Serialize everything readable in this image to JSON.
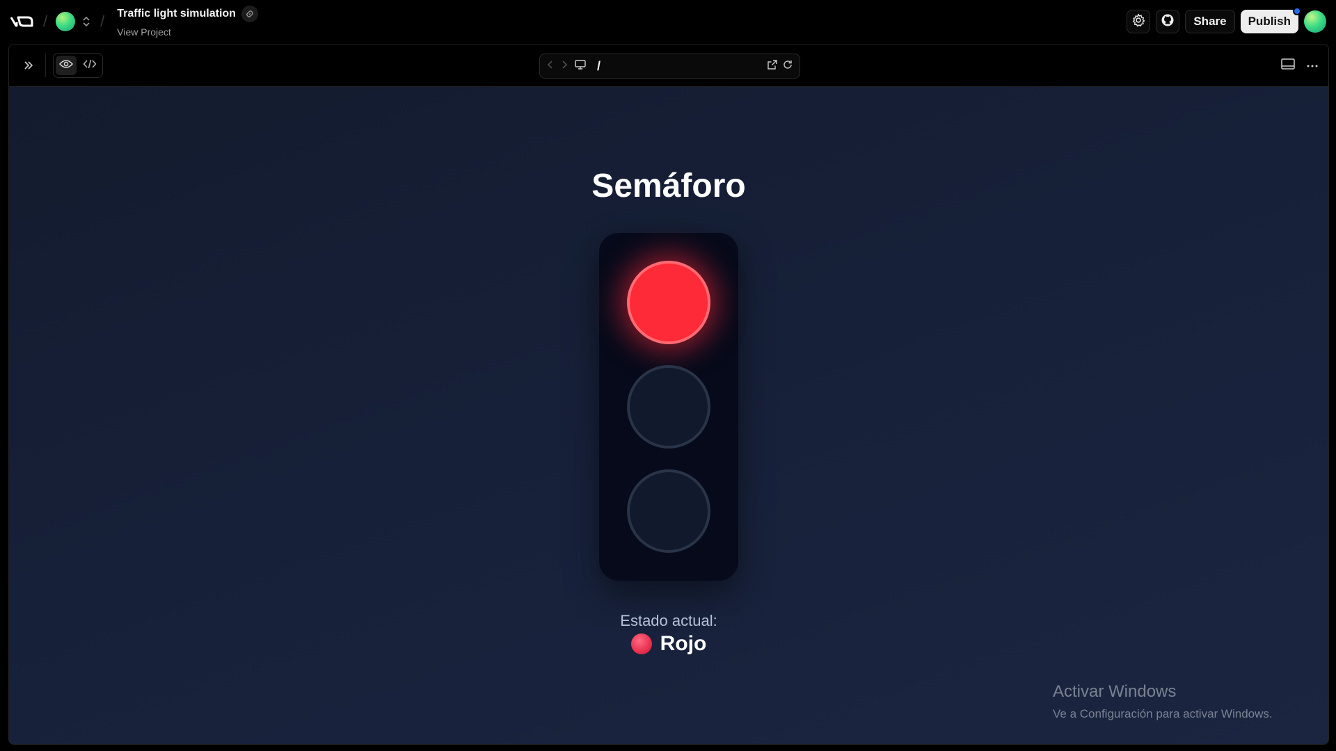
{
  "topbar": {
    "logo": "v0-logo",
    "project_title": "Traffic light simulation",
    "project_sub": "View Project",
    "share_label": "Share",
    "publish_label": "Publish"
  },
  "toolbar": {
    "url_path": "/"
  },
  "app": {
    "title": "Semáforo",
    "status_label": "Estado actual:",
    "status_value": "Rojo",
    "active_light": "red",
    "colors": {
      "red_on": "#ff2a38",
      "lamp_off": "#111a2c",
      "housing": "#060a1a",
      "background": "#17213a"
    }
  },
  "watermark": {
    "title": "Activar Windows",
    "subtitle": "Ve a Configuración para activar Windows."
  }
}
